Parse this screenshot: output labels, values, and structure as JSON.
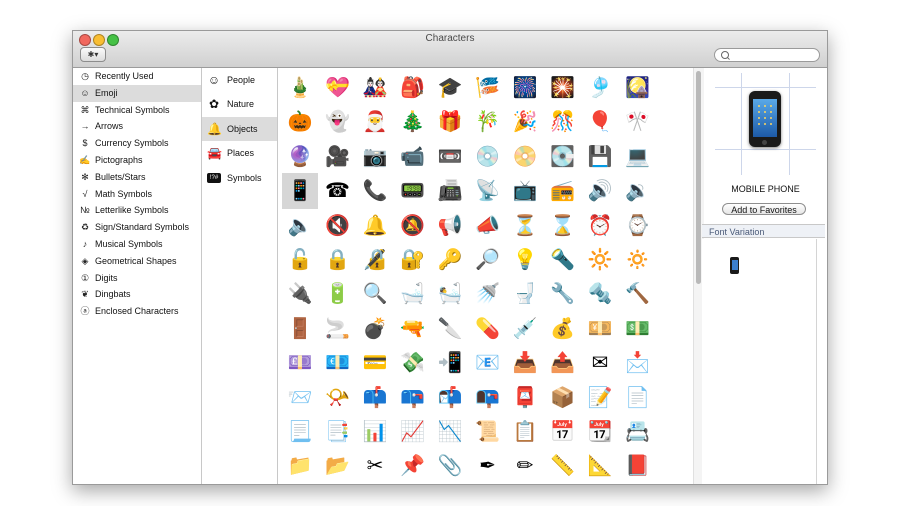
{
  "window": {
    "title": "Characters"
  },
  "toolbar": {
    "gear_label": "✱▾",
    "search_placeholder": ""
  },
  "categories": [
    {
      "label": "Recently Used",
      "icon": "clock-icon",
      "glyph": "◷"
    },
    {
      "label": "Emoji",
      "icon": "smiley-icon",
      "glyph": "☺",
      "selected": true
    },
    {
      "label": "Technical Symbols",
      "icon": "command-icon",
      "glyph": "⌘"
    },
    {
      "label": "Arrows",
      "icon": "arrow-icon",
      "glyph": "→"
    },
    {
      "label": "Currency Symbols",
      "icon": "dollar-icon",
      "glyph": "$"
    },
    {
      "label": "Pictographs",
      "icon": "pencil-icon",
      "glyph": "✍"
    },
    {
      "label": "Bullets/Stars",
      "icon": "asterisk-icon",
      "glyph": "✻"
    },
    {
      "label": "Math Symbols",
      "icon": "sqrt-icon",
      "glyph": "√"
    },
    {
      "label": "Letterlike Symbols",
      "icon": "numero-icon",
      "glyph": "№"
    },
    {
      "label": "Sign/Standard Symbols",
      "icon": "recycle-icon",
      "glyph": "♻"
    },
    {
      "label": "Musical Symbols",
      "icon": "note-icon",
      "glyph": "♪"
    },
    {
      "label": "Geometrical Shapes",
      "icon": "diamond-icon",
      "glyph": "◈"
    },
    {
      "label": "Digits",
      "icon": "circled-one-icon",
      "glyph": "①"
    },
    {
      "label": "Dingbats",
      "icon": "heart-icon",
      "glyph": "❦"
    },
    {
      "label": "Enclosed Characters",
      "icon": "circled-a-icon",
      "glyph": "ⓐ"
    }
  ],
  "subcategories": [
    {
      "label": "People",
      "icon": "face-icon",
      "glyph": "☺"
    },
    {
      "label": "Nature",
      "icon": "flower-icon",
      "glyph": "✿"
    },
    {
      "label": "Objects",
      "icon": "bell-icon",
      "glyph": "🔔",
      "selected": true
    },
    {
      "label": "Places",
      "icon": "car-icon",
      "glyph": "🚘"
    },
    {
      "label": "Symbols",
      "icon": "symbols-box-icon",
      "glyph": "!?#"
    }
  ],
  "grid_columns": 11,
  "grid_selected_index": 33,
  "grid_chars": [
    "🎍",
    "💝",
    "🎎",
    "🎒",
    "🎓",
    "🎏",
    "🎆",
    "🎇",
    "🎐",
    "🎑",
    "",
    "🎃",
    "👻",
    "🎅",
    "🎄",
    "🎁",
    "🎋",
    "🎉",
    "🎊",
    "🎈",
    "🎌",
    "",
    "🔮",
    "🎥",
    "📷",
    "📹",
    "📼",
    "💿",
    "📀",
    "💽",
    "💾",
    "💻",
    "",
    "📱",
    "☎",
    "📞",
    "📟",
    "📠",
    "📡",
    "📺",
    "📻",
    "🔊",
    "🔉",
    "",
    "🔈",
    "🔇",
    "🔔",
    "🔕",
    "📢",
    "📣",
    "⏳",
    "⌛",
    "⏰",
    "⌚",
    "",
    "🔓",
    "🔒",
    "🔏",
    "🔐",
    "🔑",
    "🔎",
    "💡",
    "🔦",
    "🔆",
    "🔅",
    "",
    "🔌",
    "🔋",
    "🔍",
    "🛁",
    "🛀",
    "🚿",
    "🚽",
    "🔧",
    "🔩",
    "🔨",
    "",
    "🚪",
    "🚬",
    "💣",
    "🔫",
    "🔪",
    "💊",
    "💉",
    "💰",
    "💴",
    "💵",
    "",
    "💷",
    "💶",
    "💳",
    "💸",
    "📲",
    "📧",
    "📥",
    "📤",
    "✉",
    "📩",
    "",
    "📨",
    "📯",
    "📫",
    "📪",
    "📬",
    "📭",
    "📮",
    "📦",
    "📝",
    "📄",
    "",
    "📃",
    "📑",
    "📊",
    "📈",
    "📉",
    "📜",
    "📋",
    "📅",
    "📆",
    "📇",
    "",
    "📁",
    "📂",
    "✂",
    "📌",
    "📎",
    "✒",
    "✏",
    "📏",
    "📐",
    "📕",
    ""
  ],
  "preview": {
    "char_name": "MOBILE PHONE",
    "add_favorites_label": "Add to Favorites",
    "char": "📱"
  },
  "font_variation": {
    "header": "Font Variation",
    "char": "📱"
  }
}
